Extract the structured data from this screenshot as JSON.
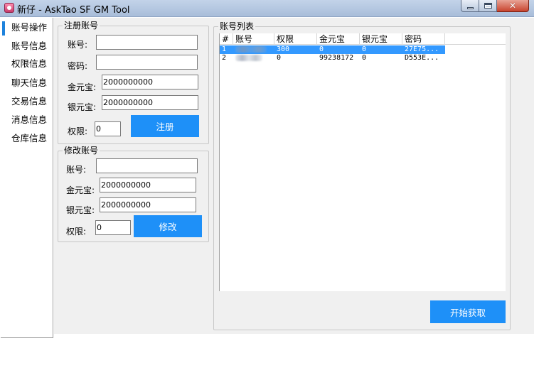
{
  "window": {
    "title": "新仔 - AskTao SF GM Tool",
    "icons": {
      "app": "app-icon",
      "minimize": "minimize-icon",
      "maximize": "maximize-icon",
      "close": "close-icon"
    },
    "close_glyph": "✕"
  },
  "sidebar": {
    "items": [
      {
        "label": "账号操作",
        "active": true
      },
      {
        "label": "账号信息"
      },
      {
        "label": "权限信息"
      },
      {
        "label": "聊天信息"
      },
      {
        "label": "交易信息"
      },
      {
        "label": "消息信息"
      },
      {
        "label": "仓库信息"
      }
    ]
  },
  "register": {
    "title": "注册账号",
    "account_label": "账号:",
    "account_value": "",
    "password_label": "密码:",
    "password_value": "",
    "gold_label": "金元宝:",
    "gold_value": "2000000000",
    "silver_label": "银元宝:",
    "silver_value": "2000000000",
    "level_label": "权限:",
    "level_value": "0",
    "button_label": "注册"
  },
  "modify": {
    "title": "修改账号",
    "account_label": "账号:",
    "account_value": "",
    "gold_label": "金元宝:",
    "gold_value": "2000000000",
    "silver_label": "银元宝:",
    "silver_value": "2000000000",
    "level_label": "权限:",
    "level_value": "0",
    "button_label": "修改"
  },
  "account_list": {
    "title": "账号列表",
    "columns": [
      "#",
      "账号",
      "权限",
      "金元宝",
      "银元宝",
      "密码"
    ],
    "rows": [
      {
        "index": "1",
        "account": "",
        "level": "300",
        "gold": "0",
        "silver": "0",
        "password": "27E75...",
        "selected": true
      },
      {
        "index": "2",
        "account": "",
        "level": "0",
        "gold": "99238172",
        "silver": "0",
        "password": "D553E...",
        "selected": false
      }
    ],
    "fetch_button_label": "开始获取"
  },
  "colors": {
    "accent": "#1e90f8",
    "selection": "#3399ff",
    "window_bg": "#f0f0f0",
    "nav_indicator": "#1e82dc"
  }
}
